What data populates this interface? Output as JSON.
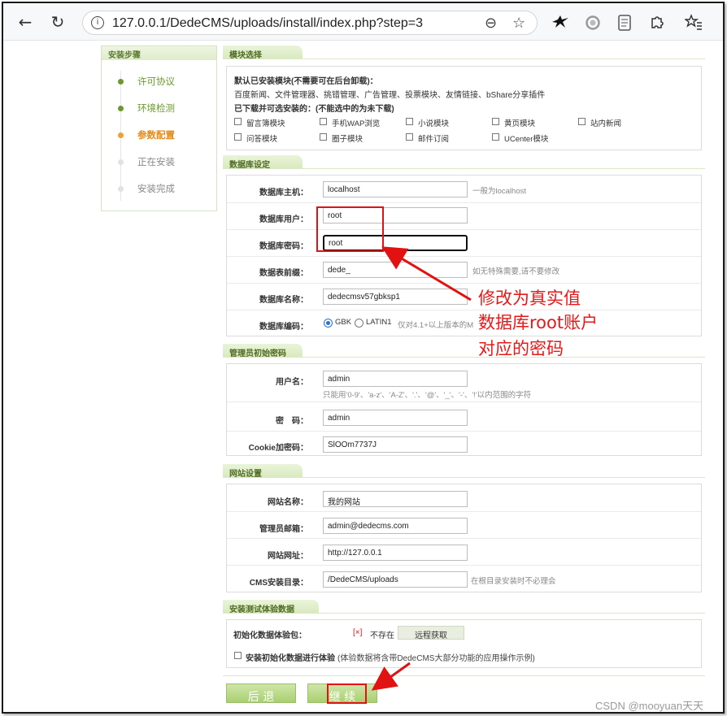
{
  "browser": {
    "url": "127.0.0.1/DedeCMS/uploads/install/index.php?step=3",
    "back_icon": "←",
    "reload_icon": "↻",
    "info_icon": "i",
    "zoom_icon": "⊖",
    "star_icon": "☆"
  },
  "steps": {
    "title": "安装步骤",
    "items": [
      {
        "label": "许可协议",
        "state": "done"
      },
      {
        "label": "环境检测",
        "state": "done"
      },
      {
        "label": "参数配置",
        "state": "current"
      },
      {
        "label": "正在安装",
        "state": "pending"
      },
      {
        "label": "安装完成",
        "state": "pending"
      }
    ]
  },
  "modules": {
    "title": "模块选择",
    "installed_heading": "默认已安装模块(不需要可在后台卸载)：",
    "installed_list": "百度新闻、文件管理器、挑错管理、广告管理、投票模块、友情链接、bShare分享插件",
    "optional_heading": "已下载并可选安装的：(不能选中的为未下载)",
    "options": [
      "留言簿模块",
      "手机WAP浏览",
      "小说模块",
      "黄页模块",
      "站内新闻",
      "问答模块",
      "圈子模块",
      "邮件订阅",
      "UCenter模块"
    ]
  },
  "database": {
    "title": "数据库设定",
    "host_label": "数据库主机：",
    "host_value": "localhost",
    "host_hint": "一般为localhost",
    "user_label": "数据库用户：",
    "user_value": "root",
    "pass_label": "数据库密码：",
    "pass_value": "root",
    "prefix_label": "数据表前缀：",
    "prefix_value": "dede_",
    "prefix_hint": "如无特殊需要,请不要修改",
    "name_label": "数据库名称：",
    "name_value": "dedecmsv57gbksp1",
    "encoding_label": "数据库编码：",
    "encoding_gbk": "GBK",
    "encoding_latin": "LATIN1",
    "encoding_hint": "仅对4.1+以上版本的M"
  },
  "admin": {
    "title": "管理员初始密码",
    "username_label": "用户名：",
    "username_value": "admin",
    "username_hint": "只能用'0-9'、'a-z'、'A-Z'、'.'、'@'、'_'、'-'、'!'以内范围的字符",
    "password_label": "密　码：",
    "password_value": "admin",
    "cookie_label": "Cookie加密码：",
    "cookie_value": "SlOOm7737J"
  },
  "site": {
    "title": "网站设置",
    "name_label": "网站名称：",
    "name_value": "我的网站",
    "email_label": "管理员邮箱：",
    "email_value": "admin@dedecms.com",
    "url_label": "网站网址：",
    "url_value": "http://127.0.0.1",
    "dir_label": "CMS安装目录：",
    "dir_value": "/DedeCMS/uploads",
    "dir_hint": "在根目录安装时不必理会"
  },
  "testdata": {
    "title": "安装测试体验数据",
    "pkg_label": "初始化数据体验包：",
    "status_mark": "[×]",
    "status_text": "不存在",
    "fetch_button": "远程获取",
    "checkbox_label": "安装初始化数据进行体验",
    "checkbox_hint": "(体验数据将含带DedeCMS大部分功能的应用操作示例)"
  },
  "buttons": {
    "back": "后 退",
    "next": "继 续"
  },
  "annotation": {
    "line1": "修改为真实值",
    "line2": "数据库root账户",
    "line3": "对应的密码"
  },
  "watermark": "CSDN @mooyuan天天",
  "colors": {
    "accent_green": "#6a9a2c",
    "current_step": "#f0a030",
    "annotation_red": "#e21212"
  }
}
